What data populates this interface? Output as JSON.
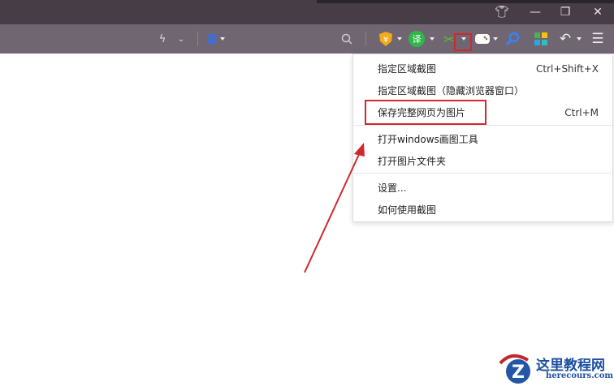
{
  "window": {
    "skin_icon": "shirt-icon",
    "minimize_icon": "minimize-icon",
    "restore_icon": "restore-icon",
    "close_icon": "close-icon"
  },
  "toolbar": {
    "icons": [
      "lightning-icon",
      "chevron-down-icon",
      "baidu-paw-icon",
      "search-icon",
      "coupon-shield-icon",
      "translate-icon",
      "scissors-screenshot-icon",
      "gamepad-icon",
      "magnifier-icon",
      "apps-grid-icon",
      "undo-icon",
      "menu-icon"
    ],
    "translate_glyph": "译",
    "coupon_glyph": "¥"
  },
  "menu": {
    "items": [
      {
        "label": "指定区域截图",
        "shortcut": "Ctrl+Shift+X"
      },
      {
        "label": "指定区域截图（隐藏浏览器窗口）",
        "shortcut": ""
      },
      {
        "label": "保存完整网页为图片",
        "shortcut": "Ctrl+M"
      },
      {
        "label": "打开windows画图工具",
        "shortcut": ""
      },
      {
        "label": "打开图片文件夹",
        "shortcut": ""
      },
      {
        "label": "设置...",
        "shortcut": ""
      },
      {
        "label": "如何使用截图",
        "shortcut": ""
      }
    ]
  },
  "watermark": {
    "title": "这里教程网",
    "url": "herecours.com"
  },
  "colors": {
    "highlight": "#d0282e",
    "titlebar": "#463d47",
    "toolbar": "#6f6671"
  }
}
